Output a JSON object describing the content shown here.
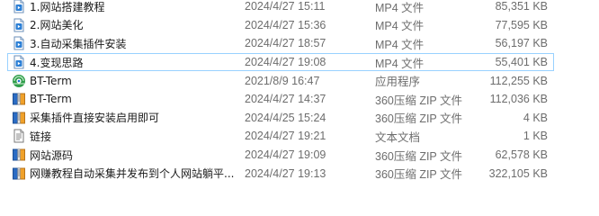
{
  "files": [
    {
      "name": "1.网站搭建教程",
      "date": "2024/4/27 15:11",
      "type": "MP4 文件",
      "size": "85,351 KB",
      "icon": "video-file-icon"
    },
    {
      "name": "2.网站美化",
      "date": "2024/4/27 15:36",
      "type": "MP4 文件",
      "size": "77,595 KB",
      "icon": "video-file-icon"
    },
    {
      "name": "3.自动采集插件安装",
      "date": "2024/4/27 18:57",
      "type": "MP4 文件",
      "size": "56,197 KB",
      "icon": "video-file-icon"
    },
    {
      "name": "4.变现思路",
      "date": "2024/4/27 19:08",
      "type": "MP4 文件",
      "size": "55,401 KB",
      "icon": "video-file-icon"
    },
    {
      "name": "BT-Term",
      "date": "2021/8/9 16:47",
      "type": "应用程序",
      "size": "112,255 KB",
      "icon": "application-icon"
    },
    {
      "name": "BT-Term",
      "date": "2024/4/27 14:37",
      "type": "360压缩 ZIP 文件",
      "size": "112,036 KB",
      "icon": "zip-archive-icon"
    },
    {
      "name": "采集插件直接安装启用即可",
      "date": "2024/4/25 15:24",
      "type": "360压缩 ZIP 文件",
      "size": "4 KB",
      "icon": "zip-archive-icon"
    },
    {
      "name": "链接",
      "date": "2024/4/27 19:21",
      "type": "文本文档",
      "size": "1 KB",
      "icon": "text-document-icon"
    },
    {
      "name": "网站源码",
      "date": "2024/4/27 19:09",
      "type": "360压缩 ZIP 文件",
      "size": "62,578 KB",
      "icon": "zip-archive-icon"
    },
    {
      "name": "网赚教程自动采集并发布到个人网站躺平...",
      "date": "2024/4/27 19:13",
      "type": "360压缩 ZIP 文件",
      "size": "322,105 KB",
      "icon": "zip-archive-icon"
    }
  ],
  "colors": {
    "selected_border": "#99d1ff",
    "secondary_text": "#6d6d6d",
    "video_icon_blue": "#2b7fd6",
    "zip_icon_orange": "#f0a12a"
  }
}
